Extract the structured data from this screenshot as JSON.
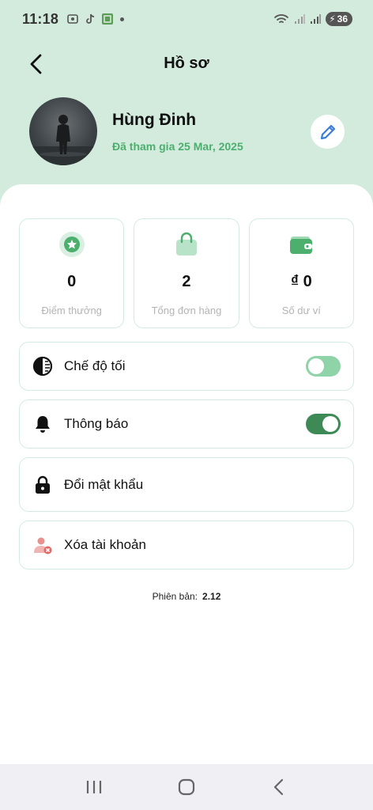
{
  "status_bar": {
    "time": "11:18",
    "battery": "36"
  },
  "header": {
    "title": "Hồ sơ",
    "back_icon": "chevron-left-icon"
  },
  "profile": {
    "name": "Hùng Đinh",
    "joined": "Đã tham gia 25 Mar, 2025",
    "edit_icon": "pencil-icon"
  },
  "stats": [
    {
      "value": "0",
      "label": "Điểm thưởng",
      "icon": "star-badge-icon"
    },
    {
      "value": "2",
      "label": "Tổng đơn hàng",
      "icon": "shopping-bag-icon"
    },
    {
      "value": "₫ 0",
      "label": "Số dư ví",
      "icon": "wallet-icon"
    }
  ],
  "settings": {
    "dark_mode": {
      "label": "Chế độ tối",
      "enabled": false
    },
    "notifications": {
      "label": "Thông báo",
      "enabled": true
    },
    "change_password": {
      "label": "Đổi mật khẩu"
    },
    "delete_account": {
      "label": "Xóa tài khoản"
    }
  },
  "version": {
    "label": "Phiên bản:",
    "value": "2.12"
  },
  "colors": {
    "header_bg": "#d3ebdd",
    "accent_green": "#4caf6d",
    "toggle_on": "#3e8a57",
    "toggle_off": "#8fd3a8",
    "edit_blue": "#3b7dd8"
  }
}
